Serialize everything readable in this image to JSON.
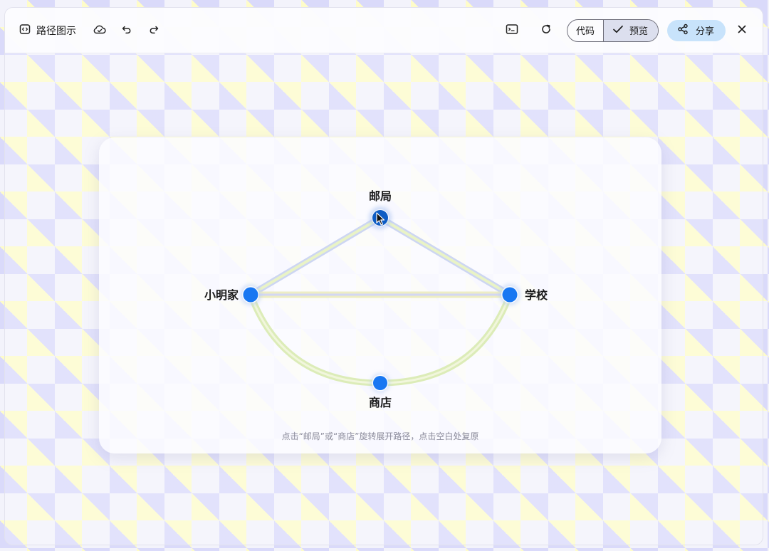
{
  "toolbar": {
    "title": "路径图示",
    "icons": {
      "title": "code-panel-icon",
      "cloud": "cloud-icon",
      "undo": "undo-icon",
      "redo": "redo-icon",
      "terminal": "terminal-icon",
      "refresh": "refresh-icon",
      "share": "share-icon",
      "close": "close-icon"
    },
    "code_label": "代码",
    "preview_label": "预览",
    "share_label": "分享"
  },
  "graph": {
    "nodes": {
      "post_office": "邮局",
      "home": "小明家",
      "school": "学校",
      "shop": "商店"
    },
    "colors": {
      "node": "#1877f2",
      "node_active": "#0e5cc4",
      "edge": "#e8f0c8"
    }
  },
  "hint": "点击“邮局”或“商店”旋转展开路径，点击空白处复原"
}
